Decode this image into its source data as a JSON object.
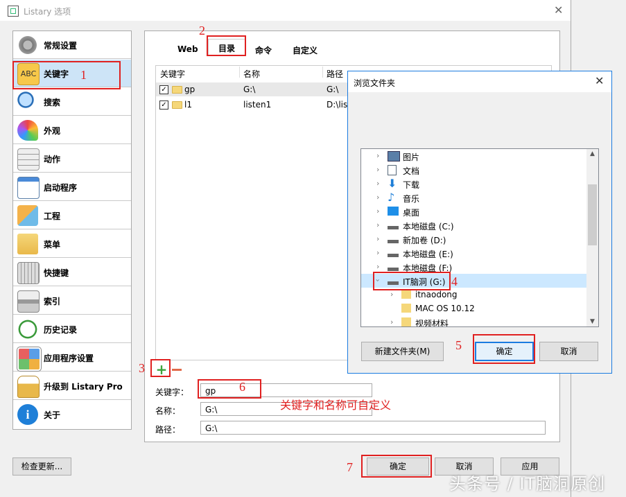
{
  "window": {
    "title": "Listary 选项"
  },
  "sidebar": {
    "items": [
      {
        "label": "常规设置"
      },
      {
        "label": "关键字"
      },
      {
        "label": "搜索"
      },
      {
        "label": "外观"
      },
      {
        "label": "动作"
      },
      {
        "label": "启动程序"
      },
      {
        "label": "工程"
      },
      {
        "label": "菜单"
      },
      {
        "label": "快捷键"
      },
      {
        "label": "索引"
      },
      {
        "label": "历史记录"
      },
      {
        "label": "应用程序设置"
      },
      {
        "label": "升级到 Listary Pro"
      },
      {
        "label": "关于"
      }
    ]
  },
  "tabs": [
    {
      "label": "Web"
    },
    {
      "label": "目录"
    },
    {
      "label": "命令"
    },
    {
      "label": "自定义"
    }
  ],
  "table": {
    "headers": [
      "关键字",
      "名称",
      "路径"
    ],
    "rows": [
      {
        "keyword": "gp",
        "name": "G:\\",
        "path": "G:\\"
      },
      {
        "keyword": "l1",
        "name": "listen1",
        "path": "D:\\list"
      }
    ]
  },
  "form": {
    "keyword_label": "关键字：",
    "keyword_value": "gp",
    "name_label": "名称：",
    "name_value": "G:\\",
    "path_label": "路径：",
    "path_value": "G:\\"
  },
  "buttons": {
    "check_updates": "检查更新...",
    "ok": "确定",
    "cancel": "取消",
    "apply": "应用"
  },
  "dialog": {
    "title": "浏览文件夹",
    "tree": [
      {
        "label": "图片"
      },
      {
        "label": "文档"
      },
      {
        "label": "下载"
      },
      {
        "label": "音乐"
      },
      {
        "label": "桌面"
      },
      {
        "label": "本地磁盘 (C:)"
      },
      {
        "label": "新加卷 (D:)"
      },
      {
        "label": "本地磁盘 (E:)"
      },
      {
        "label": "本地磁盘 (F:)"
      },
      {
        "label": "IT脑洞 (G:)"
      },
      {
        "label": "itnaodong"
      },
      {
        "label": "MAC OS 10.12"
      },
      {
        "label": "视频材料"
      }
    ],
    "new_folder": "新建文件夹(M)",
    "ok": "确定",
    "cancel": "取消"
  },
  "annotations": {
    "n1": "1",
    "n2": "2",
    "n3": "3",
    "n4": "4",
    "n5": "5",
    "n6": "6",
    "n7": "7",
    "note": "关键字和名称可自定义"
  },
  "watermark": "头条号 / IT脑洞原创",
  "colors": {
    "accent": "#1a7be0",
    "annotation": "#e02020",
    "selected": "#cde4f7"
  }
}
